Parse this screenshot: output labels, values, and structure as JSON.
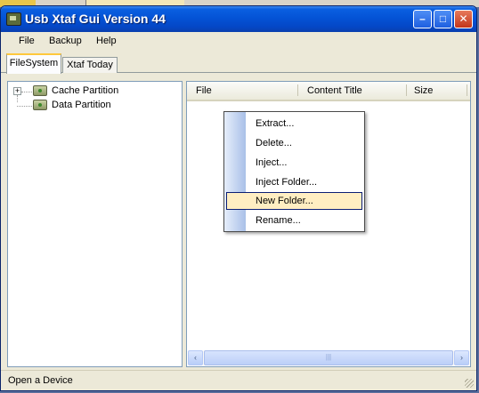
{
  "window": {
    "title": "Usb Xtaf Gui Version 44"
  },
  "title_buttons": {
    "minimize": "–",
    "maximize": "□",
    "close": "✕"
  },
  "menu": {
    "items": [
      "File",
      "Backup",
      "Help"
    ]
  },
  "tabs": [
    {
      "label": "FileSystem",
      "active": true
    },
    {
      "label": "Xtaf Today",
      "active": false
    }
  ],
  "tree": {
    "nodes": [
      {
        "label": "Cache Partition",
        "icon": "drive-icon",
        "expandable": true,
        "expander": "+"
      },
      {
        "label": "Data Partition",
        "icon": "drive-icon",
        "expandable": false
      }
    ]
  },
  "file_list": {
    "columns": [
      "File",
      "Content Title",
      "Size"
    ],
    "rows": []
  },
  "scrollbar": {
    "left_arrow": "‹",
    "right_arrow": "›",
    "thumb_grip": "|||"
  },
  "context_menu": {
    "items": [
      "Extract...",
      "Delete...",
      "Inject...",
      "Inject Folder...",
      "New Folder...",
      "Rename..."
    ],
    "highlighted": "New Folder..."
  },
  "status": {
    "text": "Open a Device"
  },
  "colors": {
    "title_blue": "#0453d6",
    "highlight": "#ffeec2",
    "window_face": "#ece9d8"
  }
}
